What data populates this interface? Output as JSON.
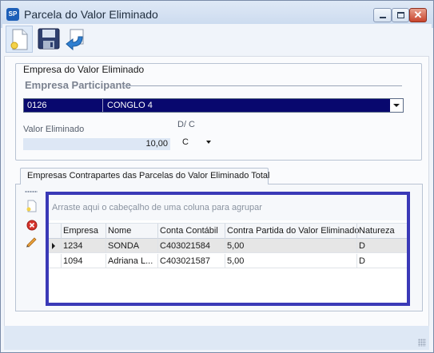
{
  "window": {
    "title": "Parcela do Valor Eliminado",
    "app_icon_text": "SP"
  },
  "toolbar": {
    "buttons": [
      {
        "name": "new",
        "icon": "new-document-icon"
      },
      {
        "name": "save",
        "icon": "save-icon"
      },
      {
        "name": "undo",
        "icon": "undo-arrow-icon"
      }
    ]
  },
  "group": {
    "legend": "Empresa do Valor Eliminado",
    "sublabel": "Empresa Participante",
    "company_code": "0126",
    "company_name": "CONGLO 4",
    "valor_label": "Valor Eliminado",
    "valor_value": "10,00",
    "dc_label": "D/ C",
    "dc_value": "C"
  },
  "tab": {
    "label": "Empresas Contrapartes das Parcelas do Valor Eliminado Total"
  },
  "grid": {
    "group_hint": "Arraste aqui o cabeçalho de uma coluna para agrupar",
    "columns": [
      "Empresa",
      "Nome",
      "Conta Contábil",
      "Contra Partida do Valor Eliminado",
      "Natureza"
    ],
    "rows": [
      {
        "empresa": "1234",
        "nome": "SONDA",
        "conta": "C403021584",
        "contra": "5,00",
        "natureza": "D"
      },
      {
        "empresa": "1094",
        "nome": "Adriana L...",
        "conta": "C403021587",
        "contra": "5,00",
        "natureza": "D"
      }
    ]
  },
  "colors": {
    "combo_selected_bg": "#08086e",
    "grid_highlight_border": "#3a39b7",
    "valor_field_bg": "#dde7f5"
  }
}
